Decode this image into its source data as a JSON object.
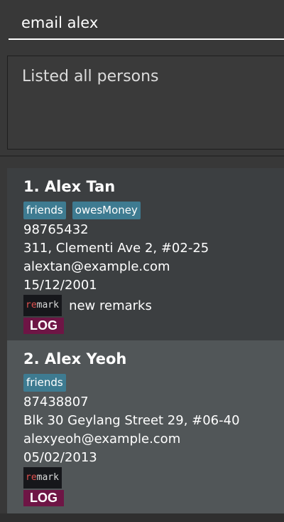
{
  "command_box": {
    "value": "email alex"
  },
  "result_display": {
    "text": "Listed all persons"
  },
  "persons": [
    {
      "index_name": "1.  Alex Tan",
      "tags": [
        "friends",
        "owesMoney"
      ],
      "phone": "98765432",
      "address": "311, Clementi Ave 2, #02-25",
      "email": "alextan@example.com",
      "date": "15/12/2001",
      "remark_badge_red": "re",
      "remark_badge_rest": "mark",
      "remark": "new remarks",
      "log_label": "LOG"
    },
    {
      "index_name": "2.  Alex Yeoh",
      "tags": [
        "friends"
      ],
      "phone": "87438807",
      "address": "Blk 30 Geylang Street 29, #06-40",
      "email": "alexyeoh@example.com",
      "date": "05/02/2013",
      "remark_badge_red": "re",
      "remark_badge_rest": "mark",
      "remark": "",
      "log_label": "LOG"
    }
  ],
  "colors": {
    "background": "#383838",
    "tag": "#3e7b91",
    "selected_card": "#515658",
    "log_button": "#6e1545",
    "remark_badge": "#16171b"
  }
}
